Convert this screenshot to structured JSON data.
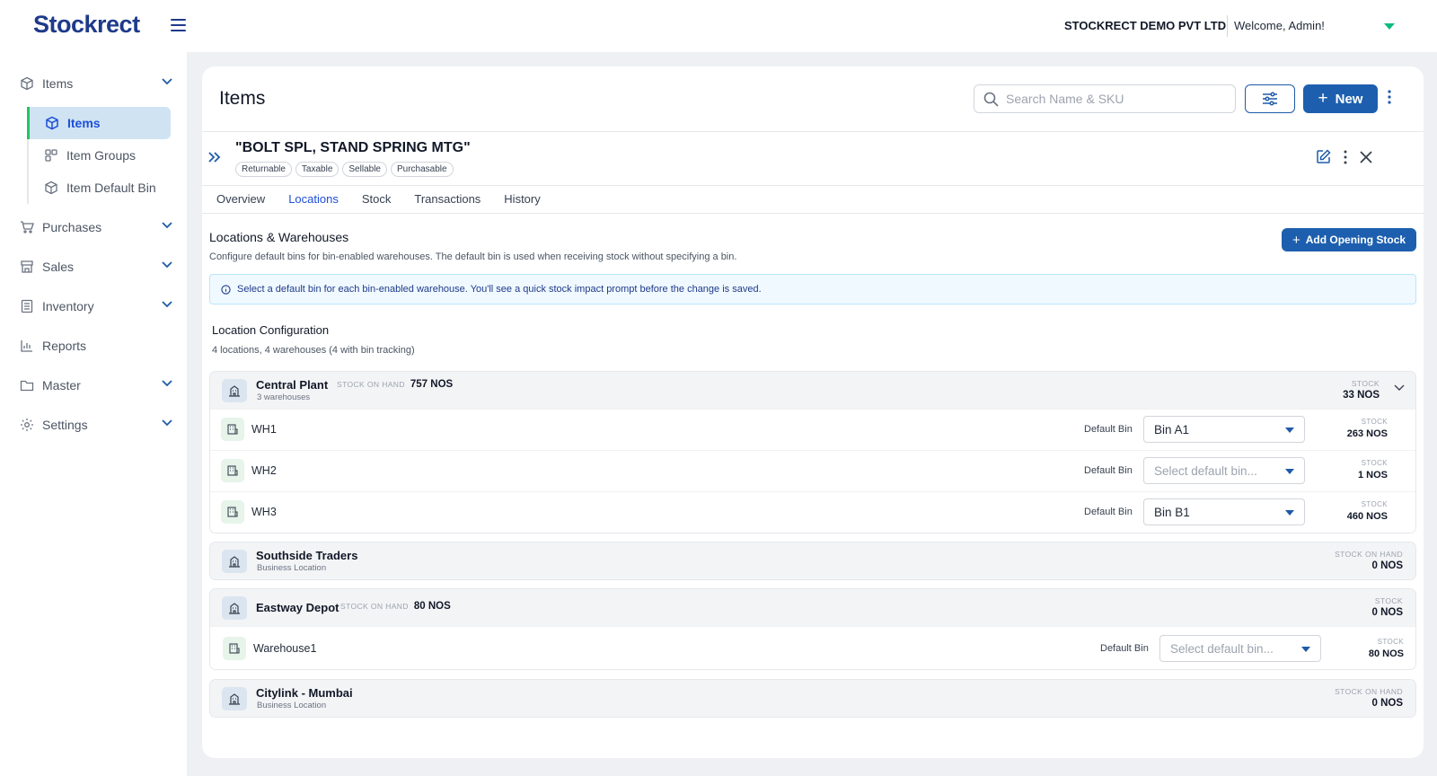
{
  "header": {
    "logo_main": "Stockrect",
    "company": "STOCKRECT DEMO PVT LTD",
    "welcome": "Welcome, Admin!",
    "accent_color": "#10b981"
  },
  "sidebar": {
    "items": [
      {
        "label": "Items",
        "icon": "cube-icon"
      },
      {
        "label": "Purchases",
        "icon": "cart-icon"
      },
      {
        "label": "Sales",
        "icon": "store-icon"
      },
      {
        "label": "Inventory",
        "icon": "list-icon"
      },
      {
        "label": "Reports",
        "icon": "chart-icon"
      },
      {
        "label": "Master",
        "icon": "folder-icon"
      },
      {
        "label": "Settings",
        "icon": "gear-icon"
      }
    ],
    "subitems": [
      {
        "label": "Items",
        "active": true
      },
      {
        "label": "Item Groups",
        "active": false
      },
      {
        "label": "Item Default Bin",
        "active": false
      }
    ]
  },
  "page": {
    "title": "Items",
    "search_placeholder": "Search Name & SKU",
    "new_label": "New"
  },
  "item": {
    "name": "\"BOLT SPL, STAND SPRING MTG\"",
    "tags": [
      "Returnable",
      "Taxable",
      "Sellable",
      "Purchasable"
    ]
  },
  "tabs": [
    "Overview",
    "Locations",
    "Stock",
    "Transactions",
    "History"
  ],
  "active_tab": "Locations",
  "locations_section": {
    "title": "Locations & Warehouses",
    "subtitle": "Configure default bins for bin-enabled warehouses. The default bin is used when receiving stock without specifying a bin.",
    "add_button": "Add Opening Stock",
    "info": "Select a default bin for each bin-enabled warehouse. You'll see a quick stock impact prompt before the change is saved.",
    "config_title": "Location Configuration",
    "config_sub": "4 locations, 4 warehouses (4 with bin tracking)"
  },
  "labels": {
    "stock_on_hand": "STOCK ON HAND",
    "stock": "STOCK",
    "default_bin": "Default Bin",
    "select_placeholder": "Select default bin..."
  },
  "locations": [
    {
      "name": "Central Plant",
      "sub": "3 warehouses",
      "soh": "757 NOS",
      "stock": "33 NOS",
      "warehouses": [
        {
          "name": "WH1",
          "bin": "Bin A1",
          "stock": "263 NOS"
        },
        {
          "name": "WH2",
          "bin": "",
          "stock": "1 NOS"
        },
        {
          "name": "WH3",
          "bin": "Bin B1",
          "stock": "460 NOS"
        }
      ]
    },
    {
      "name": "Southside Traders",
      "sub": "Business Location",
      "stock": "0 NOS"
    },
    {
      "name": "Eastway Depot",
      "soh": "80 NOS",
      "stock": "0 NOS",
      "warehouses": [
        {
          "name": "Warehouse1",
          "bin": "",
          "stock": "80 NOS"
        }
      ]
    },
    {
      "name": "Citylink - Mumbai",
      "sub": "Business Location",
      "stock": "0 NOS"
    }
  ]
}
